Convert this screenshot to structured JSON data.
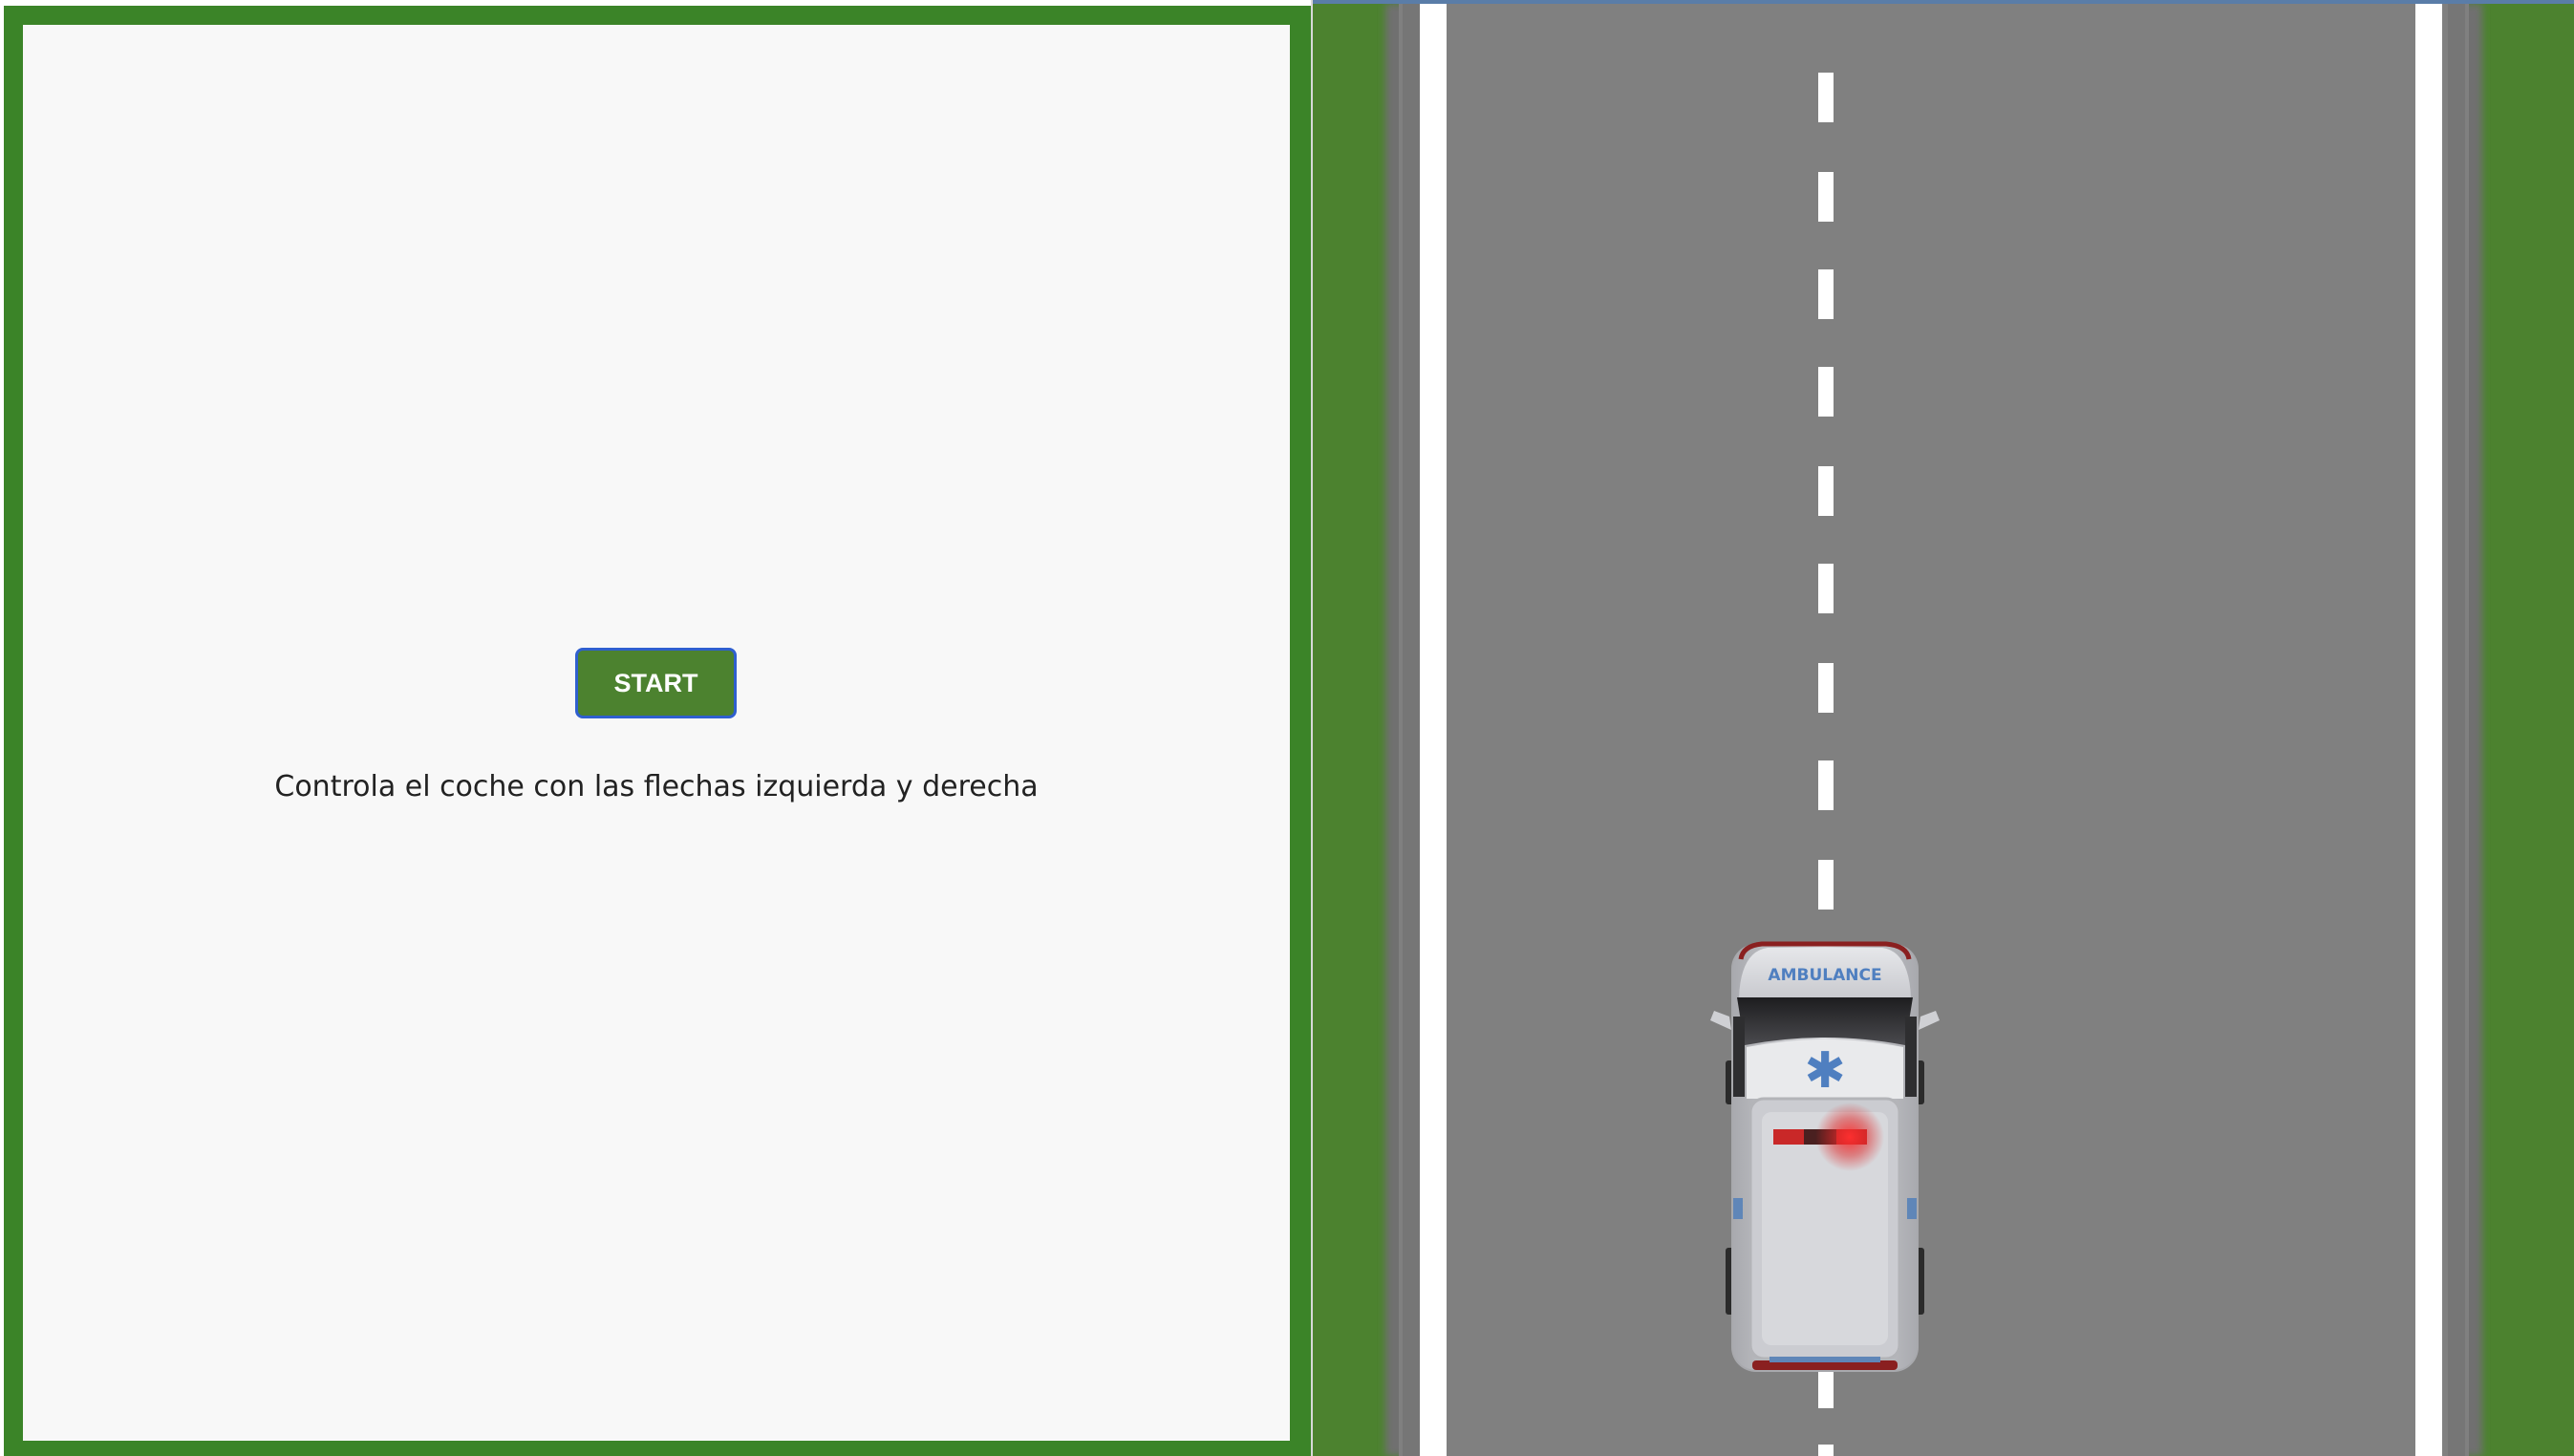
{
  "game": {
    "start_label": "START",
    "instructions": "Controla el coche con las flechas izquierda y derecha"
  },
  "player_vehicle": {
    "type": "ambulance",
    "label": "AMBULANCE",
    "symbol": "✱",
    "lane": "right"
  },
  "colors": {
    "panel_border": "#3b8428",
    "panel_background": "#f8f8f8",
    "button_background": "#4c822f",
    "button_border": "#2f5fcf",
    "grass": "#4c822f",
    "road": "#808080",
    "road_markings": "#ffffff"
  }
}
